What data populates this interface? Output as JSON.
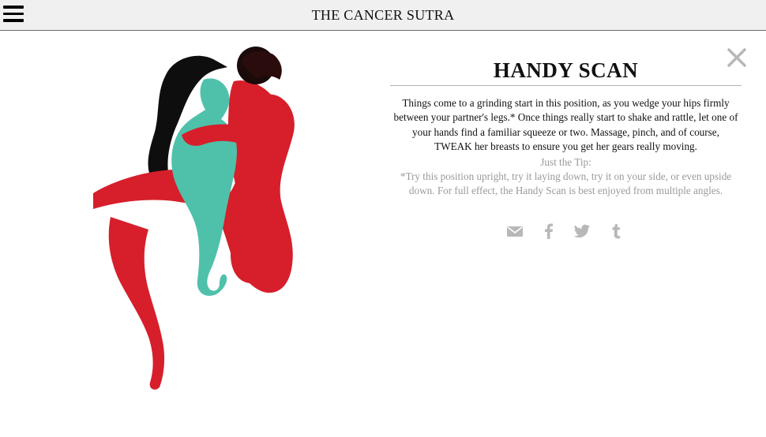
{
  "header": {
    "site_title": "THE CANCER SUTRA",
    "menu_icon": "hamburger-menu-icon"
  },
  "position": {
    "title": "HANDY SCAN",
    "description": "Things come to a grinding start in this position, as you wedge your hips firmly between your partner's legs.* Once things really start to shake and rattle, let one of your hands find a familiar squeeze or two. Massage, pinch, and of course, TWEAK her breasts to ensure you get her gears really moving.",
    "tip_label": "Just the Tip:",
    "tip_text": "*Try this position upright, try it laying down, try it on your side, or even upside down. For full effect, the Handy Scan is best enjoyed from multiple angles."
  },
  "share": {
    "icons": [
      "email-icon",
      "facebook-icon",
      "twitter-icon",
      "tumblr-icon"
    ],
    "icon_color": "#b8b8b8"
  },
  "close": {
    "icon": "close-icon",
    "color": "#b8b8b8"
  },
  "colors": {
    "teal_figure": "#4fc1ab",
    "red_figure": "#d61f2b",
    "hair": "#0e0e0e",
    "topbar_bg": "#f0f0f0"
  }
}
